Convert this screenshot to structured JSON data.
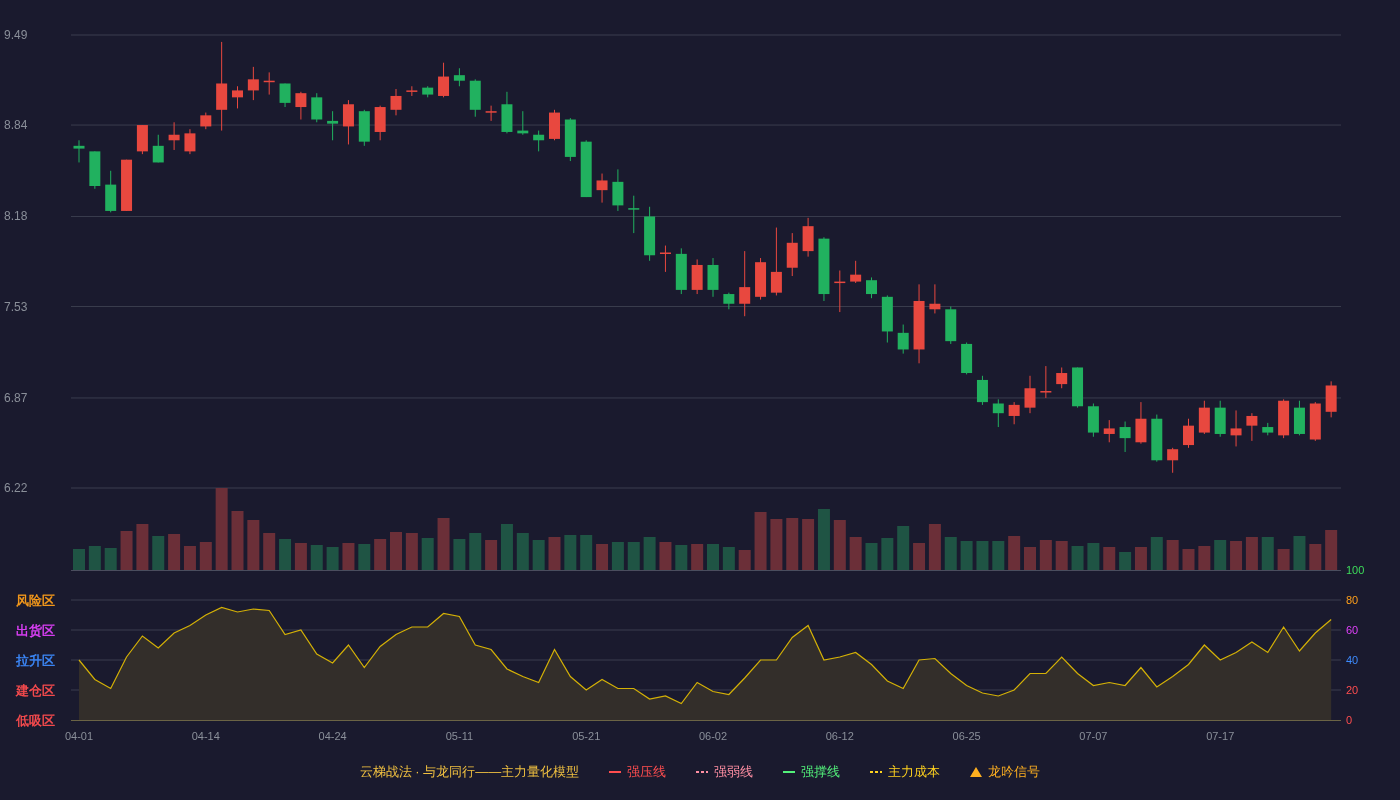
{
  "price_chart": {
    "chart_data": {
      "type": "candlestick",
      "ylim": [
        6.22,
        9.49
      ],
      "yticks": [
        9.49,
        8.84,
        8.18,
        7.53,
        6.87,
        6.22
      ],
      "grid": true,
      "ohlc": [
        [
          8.69,
          8.73,
          8.57,
          8.67
        ],
        [
          8.65,
          8.65,
          8.38,
          8.4
        ],
        [
          8.41,
          8.51,
          8.21,
          8.22
        ],
        [
          8.22,
          8.59,
          8.22,
          8.59
        ],
        [
          8.65,
          8.84,
          8.63,
          8.84
        ],
        [
          8.69,
          8.77,
          8.57,
          8.57
        ],
        [
          8.73,
          8.86,
          8.66,
          8.77
        ],
        [
          8.65,
          8.81,
          8.63,
          8.78
        ],
        [
          8.83,
          8.93,
          8.81,
          8.91
        ],
        [
          8.95,
          9.44,
          8.8,
          9.14
        ],
        [
          9.04,
          9.12,
          8.96,
          9.09
        ],
        [
          9.09,
          9.26,
          9.02,
          9.17
        ],
        [
          9.15,
          9.22,
          9.06,
          9.16
        ],
        [
          9.14,
          9.14,
          8.97,
          9.0
        ],
        [
          8.97,
          9.08,
          8.88,
          9.07
        ],
        [
          9.04,
          9.07,
          8.86,
          8.88
        ],
        [
          8.87,
          8.94,
          8.73,
          8.85
        ],
        [
          8.83,
          9.02,
          8.7,
          8.99
        ],
        [
          8.94,
          8.95,
          8.69,
          8.72
        ],
        [
          8.79,
          8.98,
          8.73,
          8.97
        ],
        [
          8.95,
          9.1,
          8.91,
          9.05
        ],
        [
          9.08,
          9.12,
          9.05,
          9.09
        ],
        [
          9.11,
          9.12,
          9.04,
          9.06
        ],
        [
          9.05,
          9.29,
          9.04,
          9.19
        ],
        [
          9.2,
          9.25,
          9.12,
          9.16
        ],
        [
          9.16,
          9.17,
          8.9,
          8.95
        ],
        [
          8.93,
          8.98,
          8.87,
          8.94
        ],
        [
          8.99,
          9.08,
          8.78,
          8.79
        ],
        [
          8.8,
          8.94,
          8.77,
          8.78
        ],
        [
          8.77,
          8.8,
          8.65,
          8.73
        ],
        [
          8.74,
          8.95,
          8.73,
          8.93
        ],
        [
          8.88,
          8.89,
          8.58,
          8.61
        ],
        [
          8.72,
          8.73,
          8.32,
          8.32
        ],
        [
          8.37,
          8.49,
          8.28,
          8.44
        ],
        [
          8.43,
          8.52,
          8.22,
          8.26
        ],
        [
          8.24,
          8.33,
          8.06,
          8.23
        ],
        [
          8.18,
          8.25,
          7.86,
          7.9
        ],
        [
          7.91,
          7.97,
          7.78,
          7.92
        ],
        [
          7.91,
          7.95,
          7.62,
          7.65
        ],
        [
          7.65,
          7.87,
          7.62,
          7.83
        ],
        [
          7.83,
          7.88,
          7.6,
          7.65
        ],
        [
          7.62,
          7.63,
          7.51,
          7.55
        ],
        [
          7.55,
          7.93,
          7.46,
          7.67
        ],
        [
          7.6,
          7.88,
          7.58,
          7.85
        ],
        [
          7.63,
          8.1,
          7.61,
          7.78
        ],
        [
          7.81,
          8.06,
          7.75,
          7.99
        ],
        [
          7.93,
          8.17,
          7.89,
          8.11
        ],
        [
          8.02,
          8.03,
          7.57,
          7.62
        ],
        [
          7.7,
          7.79,
          7.49,
          7.71
        ],
        [
          7.71,
          7.86,
          7.7,
          7.76
        ],
        [
          7.72,
          7.74,
          7.59,
          7.62
        ],
        [
          7.6,
          7.61,
          7.27,
          7.35
        ],
        [
          7.34,
          7.4,
          7.19,
          7.22
        ],
        [
          7.22,
          7.69,
          7.12,
          7.57
        ],
        [
          7.51,
          7.69,
          7.48,
          7.55
        ],
        [
          7.51,
          7.53,
          7.26,
          7.28
        ],
        [
          7.26,
          7.27,
          7.04,
          7.05
        ],
        [
          7.0,
          7.03,
          6.82,
          6.84
        ],
        [
          6.83,
          6.86,
          6.66,
          6.76
        ],
        [
          6.74,
          6.84,
          6.68,
          6.82
        ],
        [
          6.8,
          7.03,
          6.76,
          6.94
        ],
        [
          6.91,
          7.1,
          6.87,
          6.92
        ],
        [
          6.97,
          7.09,
          6.94,
          7.05
        ],
        [
          7.09,
          7.09,
          6.8,
          6.81
        ],
        [
          6.81,
          6.83,
          6.59,
          6.62
        ],
        [
          6.61,
          6.71,
          6.55,
          6.65
        ],
        [
          6.66,
          6.7,
          6.48,
          6.58
        ],
        [
          6.55,
          6.84,
          6.54,
          6.72
        ],
        [
          6.72,
          6.75,
          6.41,
          6.42
        ],
        [
          6.42,
          6.51,
          6.33,
          6.5
        ],
        [
          6.53,
          6.72,
          6.51,
          6.67
        ],
        [
          6.62,
          6.85,
          6.61,
          6.8
        ],
        [
          6.8,
          6.85,
          6.59,
          6.61
        ],
        [
          6.6,
          6.78,
          6.52,
          6.65
        ],
        [
          6.67,
          6.76,
          6.56,
          6.74
        ],
        [
          6.66,
          6.69,
          6.6,
          6.62
        ],
        [
          6.6,
          6.86,
          6.58,
          6.85
        ],
        [
          6.8,
          6.85,
          6.6,
          6.61
        ],
        [
          6.57,
          6.84,
          6.56,
          6.83
        ],
        [
          6.77,
          6.99,
          6.73,
          6.96
        ]
      ]
    }
  },
  "indicator_chart": {
    "zones": [
      {
        "label": "风险区",
        "color": "#ff9f1a"
      },
      {
        "label": "出货区",
        "color": "#e040fb"
      },
      {
        "label": "拉升区",
        "color": "#3d8bff"
      },
      {
        "label": "建仓区",
        "color": "#ff4d4f"
      },
      {
        "label": "低吸区",
        "color": "#ff4d4f"
      }
    ],
    "date_labels": [
      "04-01",
      "04-14",
      "04-24",
      "05-11",
      "05-21",
      "06-02",
      "06-12",
      "06-25",
      "07-07",
      "07-17"
    ],
    "chart_data": {
      "type": "area",
      "ylim": [
        0,
        100
      ],
      "grid": true,
      "yticks": [
        100,
        80,
        60,
        40,
        20,
        0
      ],
      "series": [
        {
          "color": "#d4b106",
          "values": [
            40,
            27,
            21,
            42,
            56,
            48,
            58,
            63,
            70,
            75,
            72,
            74,
            73,
            57,
            60,
            44,
            38,
            50,
            35,
            49,
            57,
            62,
            62,
            71,
            69,
            50,
            47,
            34,
            29,
            25,
            47,
            29,
            20,
            27,
            21,
            21,
            14,
            16,
            11,
            25,
            19,
            17,
            28,
            40,
            40,
            55,
            63,
            40,
            42,
            45,
            37,
            26,
            21,
            40,
            41,
            31,
            23,
            18,
            16,
            20,
            31,
            31,
            42,
            31,
            23,
            25,
            23,
            35,
            22,
            29,
            37,
            50,
            40,
            45,
            52,
            45,
            62,
            46,
            58,
            67
          ]
        }
      ]
    }
  },
  "legend": {
    "title": "云梯战法 · 与龙同行——主力量化模型",
    "items": [
      {
        "label": "强压线",
        "kind": "line",
        "color": "#ff4d4f"
      },
      {
        "label": "强弱线",
        "kind": "dashed",
        "color": "#ff8fa3"
      },
      {
        "label": "强撑线",
        "kind": "line",
        "color": "#52f07a"
      },
      {
        "label": "主力成本",
        "kind": "dashed",
        "color": "#ffd21f"
      },
      {
        "label": "龙吟信号",
        "kind": "triangle",
        "color": "#ffb020"
      }
    ]
  }
}
